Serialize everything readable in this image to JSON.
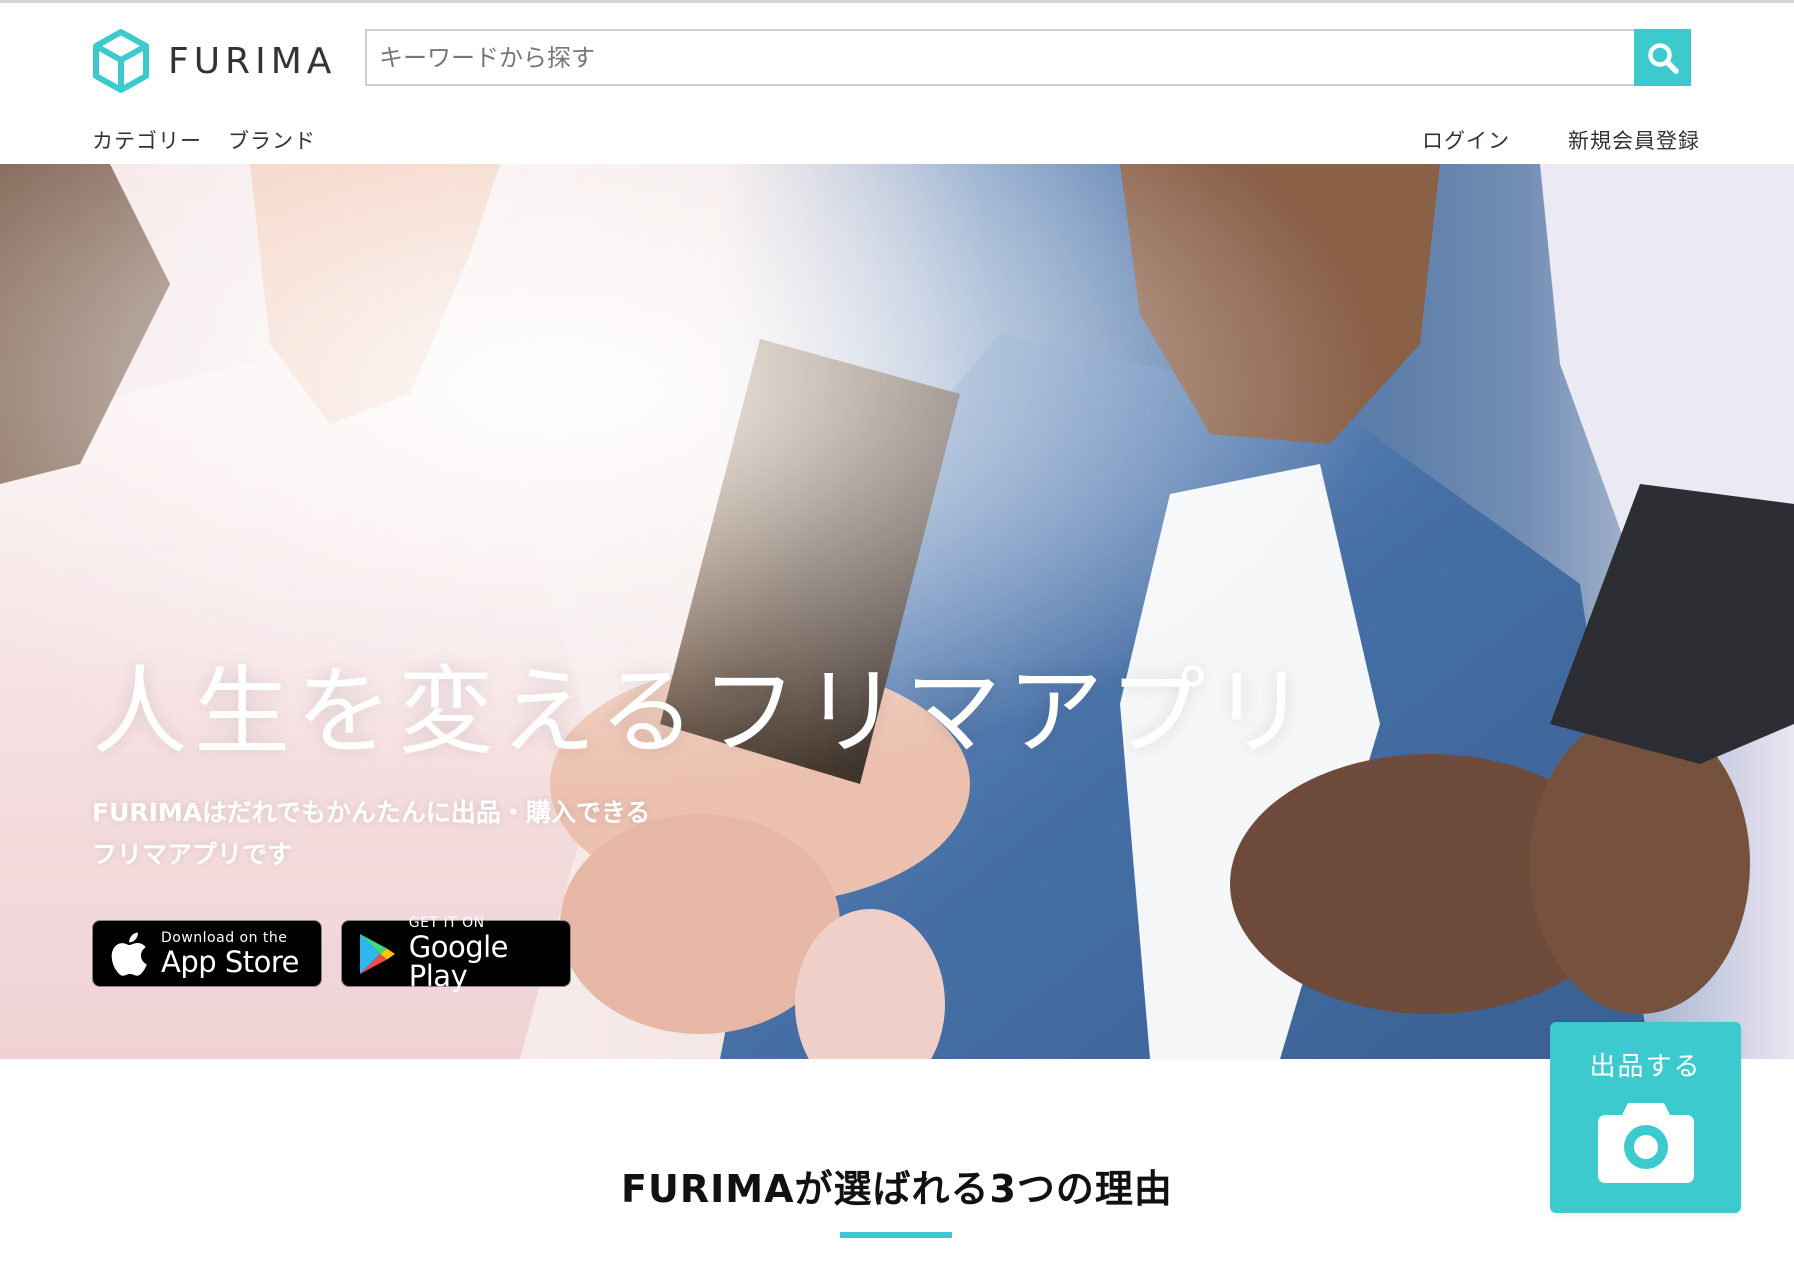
{
  "colors": {
    "accent": "#3ccace",
    "text": "#333333",
    "header_bg": "#ffffff"
  },
  "header": {
    "logo_text": "FURIMA",
    "logo_icon": "cube-icon",
    "search": {
      "placeholder": "キーワードから探す",
      "value": "",
      "button_icon": "search-icon"
    },
    "nav_left": [
      {
        "label": "カテゴリー"
      },
      {
        "label": "ブランド"
      }
    ],
    "nav_right": [
      {
        "label": "ログイン"
      },
      {
        "label": "新規会員登録"
      }
    ]
  },
  "hero": {
    "title": "人生を変えるフリマアプリ",
    "subtitle_line1": "FURIMAはだれでもかんたんに出品・購入できる",
    "subtitle_line2": "フリマアプリです",
    "app_store": {
      "small": "Download on the",
      "big": "App Store",
      "icon": "apple-icon"
    },
    "google_play": {
      "small": "GET IT ON",
      "big": "Google Play",
      "icon": "google-play-icon"
    }
  },
  "sell_button": {
    "label": "出品する",
    "icon": "camera-icon"
  },
  "reasons": {
    "title": "FURIMAが選ばれる3つの理由"
  }
}
